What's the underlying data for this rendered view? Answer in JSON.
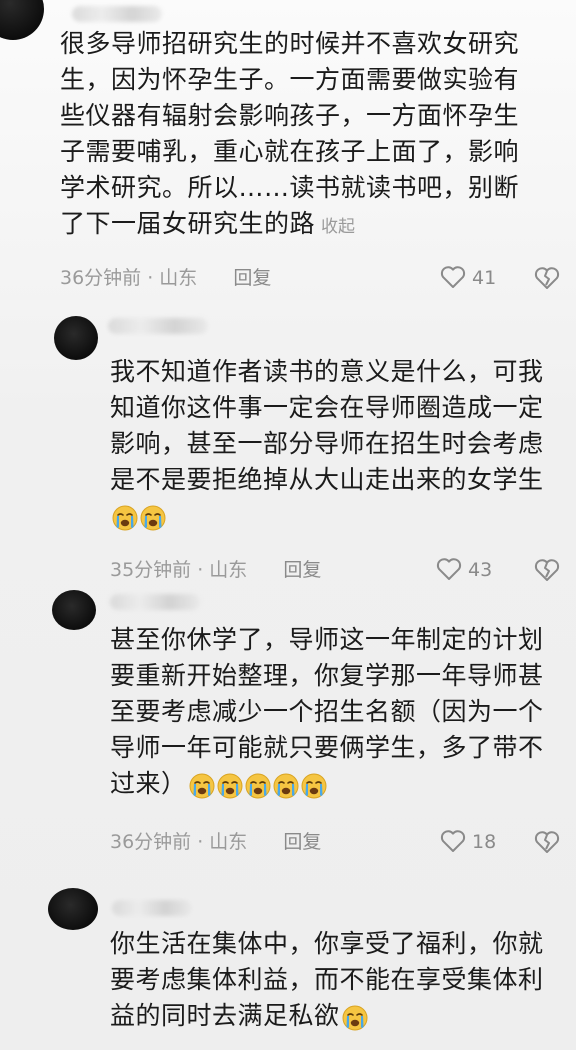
{
  "comments": [
    {
      "text": "很多导师招研究生的时候并不喜欢女研究生，因为怀孕生子。一方面需要做实验有些仪器有辐射会影响孩子，一方面怀孕生子需要哺乳，重心就在孩子上面了，影响学术研究。所以……读书就读书吧，别断了下一届女研究生的路",
      "lines": [
        "很多导师招研究生的时候并不喜欢女研究",
        "生，因为怀孕生子。一方面需要做实验有",
        "些仪器有辐射会影响孩子，一方面怀孕生",
        "子需要哺乳，重心就在孩子上面了，影响",
        "学术研究。所以……读书就读书吧，别断",
        "了下一届女研究生的路"
      ],
      "collapse_label": "收起",
      "time": "36分钟前 · 山东",
      "reply_label": "回复",
      "likes": "41",
      "emoji_count": 0
    },
    {
      "lines": [
        "我不知道作者读书的意义是什么，可我",
        "知道你这件事一定会在导师圈造成一定",
        "影响，甚至一部分导师在招生时会考虑",
        "是不是要拒绝掉从大山走出来的女学生"
      ],
      "time": "35分钟前 · 山东",
      "reply_label": "回复",
      "likes": "43",
      "emoji_count": 2
    },
    {
      "lines": [
        "甚至你休学了，导师这一年制定的计划",
        "要重新开始整理，你复学那一年导师甚",
        "至要考虑减少一个招生名额（因为一个",
        "导师一年可能就只要俩学生，多了带不",
        "过来）"
      ],
      "time": "36分钟前 · 山东",
      "reply_label": "回复",
      "likes": "18",
      "emoji_count": 5
    },
    {
      "lines": [
        "你生活在集体中，你享受了福利，你就",
        "要考虑集体利益，而不能在享受集体利",
        "益的同时去满足私欲"
      ],
      "emoji_count": 1
    }
  ],
  "icons": {
    "like": "heart-outline-icon",
    "dislike": "broken-heart-icon",
    "emoji": "loudly-crying-face-emoji"
  },
  "colors": {
    "text": "#1b1b1b",
    "meta": "#9a9a9a",
    "emoji_face": "#f5c542",
    "tears": "#4aa8e8"
  }
}
